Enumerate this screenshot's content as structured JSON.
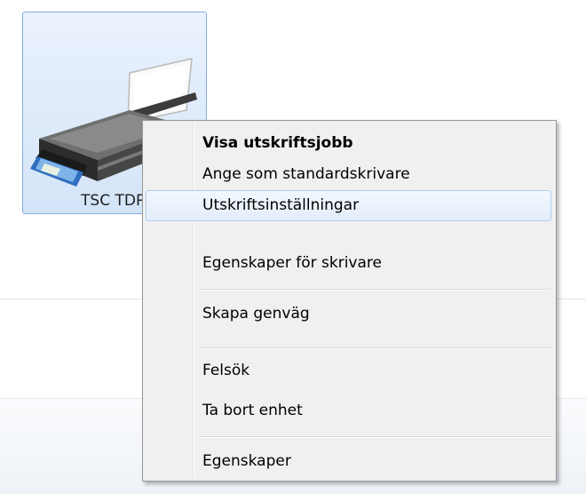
{
  "device": {
    "label": "TSC TDP-",
    "icon": "printer-icon"
  },
  "context_menu": {
    "items": [
      {
        "label": "Visa utskriftsjobb",
        "bold": true
      },
      {
        "label": "Ange som standardskrivare"
      },
      {
        "label": "Utskriftsinställningar",
        "hover": true
      },
      {
        "label": "Egenskaper för skrivare"
      },
      {
        "label": "Skapa genväg"
      },
      {
        "label": "Felsök"
      },
      {
        "label": "Ta bort enhet"
      },
      {
        "label": "Egenskaper"
      }
    ]
  },
  "colors": {
    "selection_border": "#84acdd",
    "hover_border": "#b0cdf0",
    "menu_background": "#f0f0f0"
  }
}
